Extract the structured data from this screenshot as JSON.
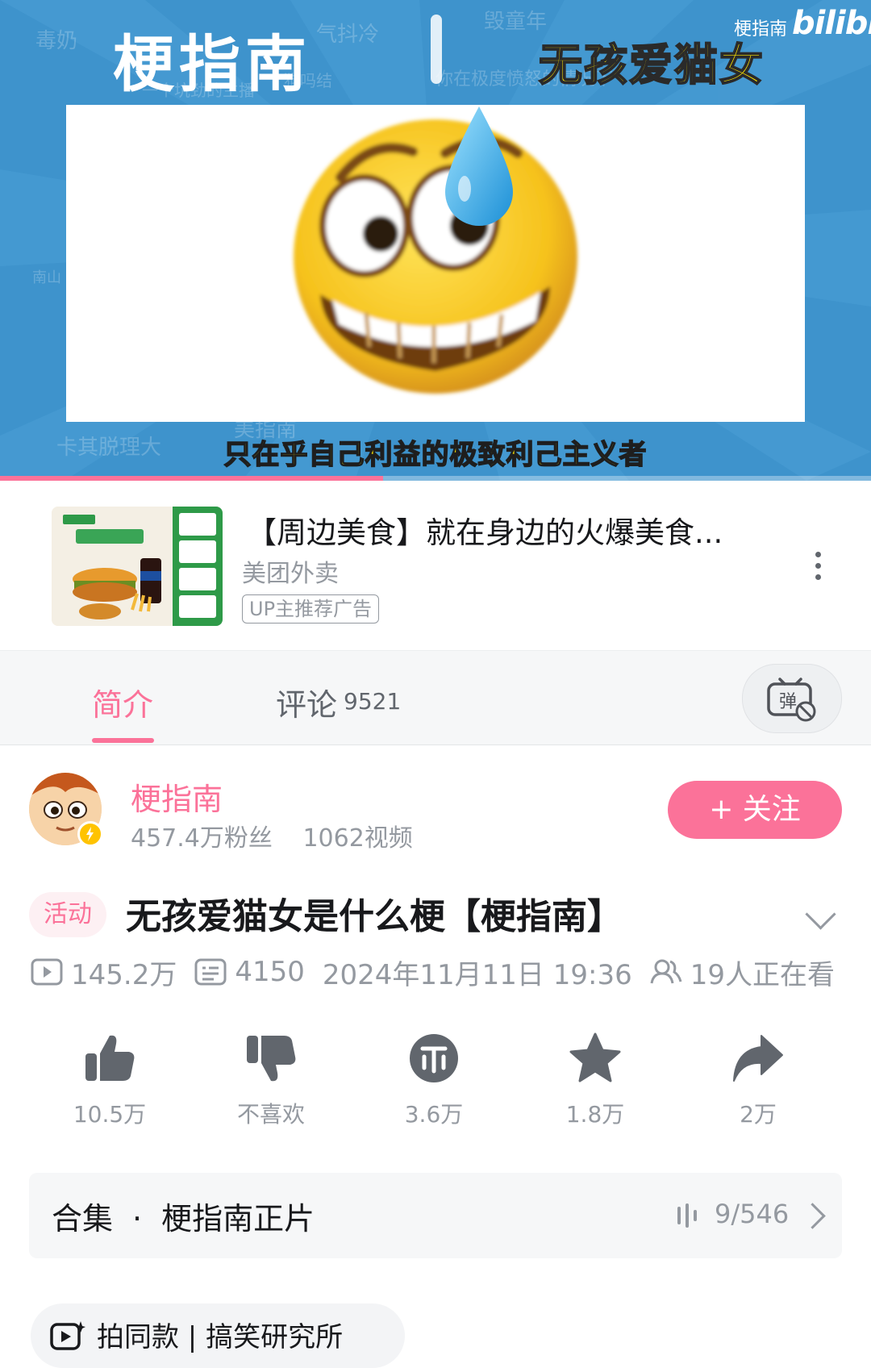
{
  "player": {
    "brand": "梗指南",
    "topic": "无孩爱猫女",
    "watermark_name": "梗指南",
    "watermark_logo": "bilibili",
    "caption": "只在乎自己利益的极致利己主义者",
    "progress": 0.44,
    "background_words": [
      "毒奶",
      "气抖冷",
      "毁童年",
      "一个坑劲的主播",
      "狗吗结",
      "你在极度愤怒的情况下",
      "卡其脱理大",
      "美指南",
      "南山"
    ]
  },
  "ad": {
    "title": "【周边美食】就在身边的火爆美食...",
    "advertiser": "美团外卖",
    "tag": "UP主推荐广告"
  },
  "tabs": {
    "intro": "简介",
    "comments": "评论",
    "comments_count": "9521",
    "danmaku_icon": "danmaku-off-icon"
  },
  "uploader": {
    "name": "梗指南",
    "fans": "457.4万粉丝",
    "videos": "1062视频",
    "follow_label": "+ 关注"
  },
  "video": {
    "activity_tag": "活动",
    "title": "无孩爱猫女是什么梗【梗指南】",
    "views": "145.2万",
    "danmaku": "4150",
    "date": "2024年11月11日 19:36",
    "watching": "19人正在看"
  },
  "actions": [
    {
      "icon": "thumbs-up-icon",
      "label": "10.5万"
    },
    {
      "icon": "thumbs-down-icon",
      "label": "不喜欢"
    },
    {
      "icon": "coin-icon",
      "label": "3.6万"
    },
    {
      "icon": "star-icon",
      "label": "1.8万"
    },
    {
      "icon": "share-icon",
      "label": "2万"
    }
  ],
  "collection": {
    "label": "合集",
    "separator": "·",
    "name": "梗指南正片",
    "progress": "9/546"
  },
  "chip": {
    "text": "拍同款 | 搞笑研究所"
  },
  "colors": {
    "accent": "#fb7299",
    "player_bg": "#3e93cc",
    "caption": "#ffe600",
    "muted": "#9499a0"
  }
}
